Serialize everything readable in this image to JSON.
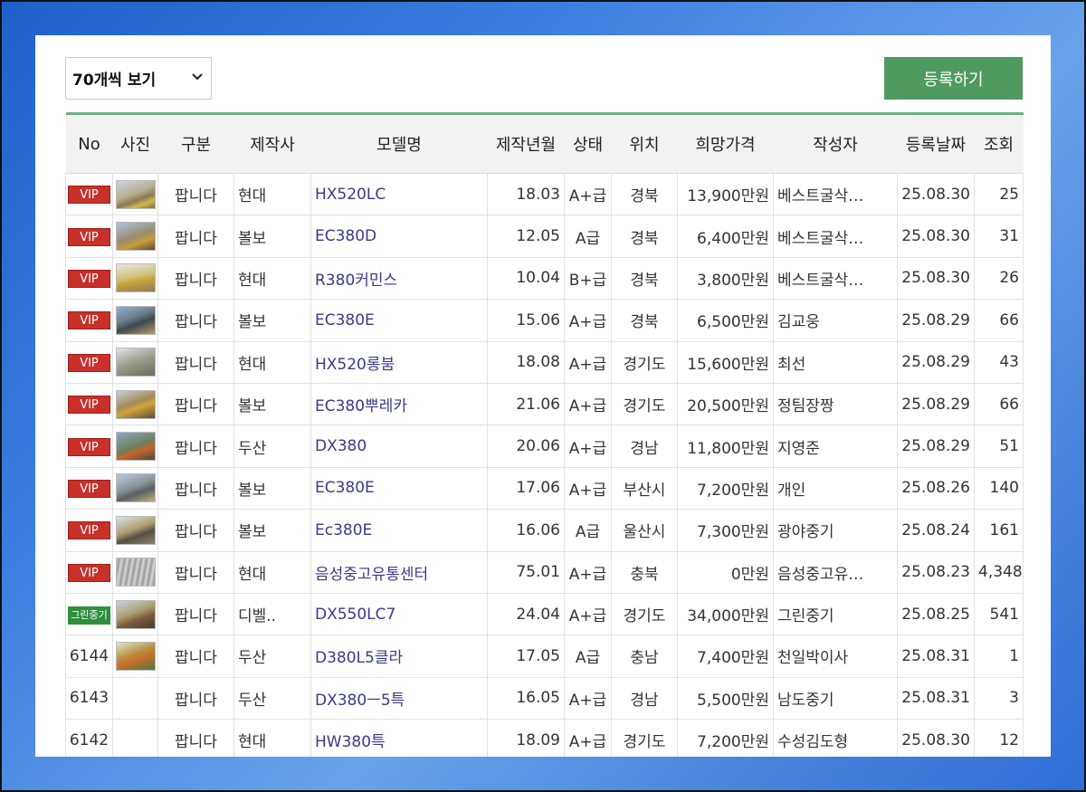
{
  "toolbar": {
    "page_size_label": "70개씩 보기",
    "register_label": "등록하기"
  },
  "table": {
    "headers": [
      "No",
      "사진",
      "구분",
      "제작사",
      "모델명",
      "제작년월",
      "상태",
      "위치",
      "희망가격",
      "작성자",
      "등록날짜",
      "조회"
    ],
    "rows": [
      {
        "no": "",
        "badge": "VIP",
        "type": "팝니다",
        "maker": "현대",
        "model": "HX520LC",
        "date": "18.03",
        "grade": "A+급",
        "location": "경북",
        "price": "13,900만원",
        "author": "베스트굴삭…",
        "reg_date": "25.08.30",
        "views": "25"
      },
      {
        "no": "",
        "badge": "VIP",
        "type": "팝니다",
        "maker": "볼보",
        "model": "EC380D",
        "date": "12.05",
        "grade": "A급",
        "location": "경북",
        "price": "6,400만원",
        "author": "베스트굴삭…",
        "reg_date": "25.08.30",
        "views": "31"
      },
      {
        "no": "",
        "badge": "VIP",
        "type": "팝니다",
        "maker": "현대",
        "model": "R380커민스",
        "date": "10.04",
        "grade": "B+급",
        "location": "경북",
        "price": "3,800만원",
        "author": "베스트굴삭…",
        "reg_date": "25.08.30",
        "views": "26"
      },
      {
        "no": "",
        "badge": "VIP",
        "type": "팝니다",
        "maker": "볼보",
        "model": "EC380E",
        "date": "15.06",
        "grade": "A+급",
        "location": "경북",
        "price": "6,500만원",
        "author": "김교웅",
        "reg_date": "25.08.29",
        "views": "66"
      },
      {
        "no": "",
        "badge": "VIP",
        "type": "팝니다",
        "maker": "현대",
        "model": "HX520롱붐",
        "date": "18.08",
        "grade": "A+급",
        "location": "경기도",
        "price": "15,600만원",
        "author": "최선",
        "reg_date": "25.08.29",
        "views": "43"
      },
      {
        "no": "",
        "badge": "VIP",
        "type": "팝니다",
        "maker": "볼보",
        "model": "EC380뿌레카",
        "date": "21.06",
        "grade": "A+급",
        "location": "경기도",
        "price": "20,500만원",
        "author": "정팀장짱",
        "reg_date": "25.08.29",
        "views": "66"
      },
      {
        "no": "",
        "badge": "VIP",
        "type": "팝니다",
        "maker": "두산",
        "model": "DX380",
        "date": "20.06",
        "grade": "A+급",
        "location": "경남",
        "price": "11,800만원",
        "author": "지영준",
        "reg_date": "25.08.29",
        "views": "51"
      },
      {
        "no": "",
        "badge": "VIP",
        "type": "팝니다",
        "maker": "볼보",
        "model": "EC380E",
        "date": "17.06",
        "grade": "A+급",
        "location": "부산시",
        "price": "7,200만원",
        "author": "개인",
        "reg_date": "25.08.26",
        "views": "140"
      },
      {
        "no": "",
        "badge": "VIP",
        "type": "팝니다",
        "maker": "볼보",
        "model": "Ec380E",
        "date": "16.06",
        "grade": "A급",
        "location": "울산시",
        "price": "7,300만원",
        "author": "광야중기",
        "reg_date": "25.08.24",
        "views": "161"
      },
      {
        "no": "",
        "badge": "VIP",
        "type": "팝니다",
        "maker": "현대",
        "model": "음성중고유통센터",
        "date": "75.01",
        "grade": "A+급",
        "location": "충북",
        "price": "0만원",
        "author": "음성중고유…",
        "reg_date": "25.08.23",
        "views": "4,348"
      },
      {
        "no": "",
        "badge": "그린중기",
        "type": "팝니다",
        "maker": "디벨..",
        "model": "DX550LC7",
        "date": "24.04",
        "grade": "A+급",
        "location": "경기도",
        "price": "34,000만원",
        "author": "그린중기",
        "reg_date": "25.08.25",
        "views": "541"
      },
      {
        "no": "6144",
        "badge": "",
        "type": "팝니다",
        "maker": "두산",
        "model": "D380L5클라",
        "date": "17.05",
        "grade": "A급",
        "location": "충남",
        "price": "7,400만원",
        "author": "천일박이사",
        "reg_date": "25.08.31",
        "views": "1"
      },
      {
        "no": "6143",
        "badge": "",
        "type": "팝니다",
        "maker": "두산",
        "model": "DX380ㅡ5특",
        "date": "16.05",
        "grade": "A+급",
        "location": "경남",
        "price": "5,500만원",
        "author": "남도중기",
        "reg_date": "25.08.31",
        "views": "3"
      },
      {
        "no": "6142",
        "badge": "",
        "type": "팝니다",
        "maker": "현대",
        "model": "HW380특",
        "date": "18.09",
        "grade": "A+급",
        "location": "경기도",
        "price": "7,200만원",
        "author": "수성김도형",
        "reg_date": "25.08.30",
        "views": "12"
      }
    ]
  }
}
